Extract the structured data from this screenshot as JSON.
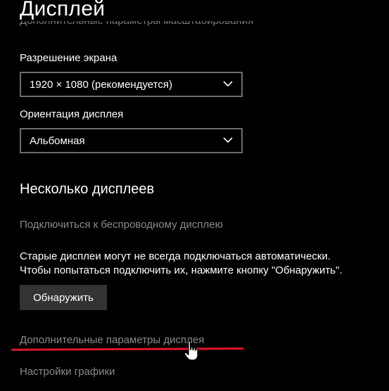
{
  "page": {
    "title": "Дисплей",
    "cut_link": "Дополнительные параметры масштабирования"
  },
  "resolution": {
    "label": "Разрешение экрана",
    "value": "1920 × 1080 (рекомендуется)"
  },
  "orientation": {
    "label": "Ориентация дисплея",
    "value": "Альбомная"
  },
  "multiple_displays": {
    "title": "Несколько дисплеев",
    "wireless_link": "Подключиться к беспроводному дисплею",
    "description_line1": "Старые дисплеи могут не всегда подключаться автоматически.",
    "description_line2": "Чтобы попытаться подключить их, нажмите кнопку \"Обнаружить\".",
    "detect_button": "Обнаружить"
  },
  "links": {
    "advanced_display": "Дополнительные параметры дисплея",
    "graphics_settings": "Настройки графики"
  },
  "colors": {
    "background": "#000000",
    "annotation_underline": "#e0152a",
    "link_gray": "#8a8a8a"
  },
  "icons": {
    "dropdown": "chevron-down-icon",
    "pointer": "hand-pointer-icon"
  }
}
